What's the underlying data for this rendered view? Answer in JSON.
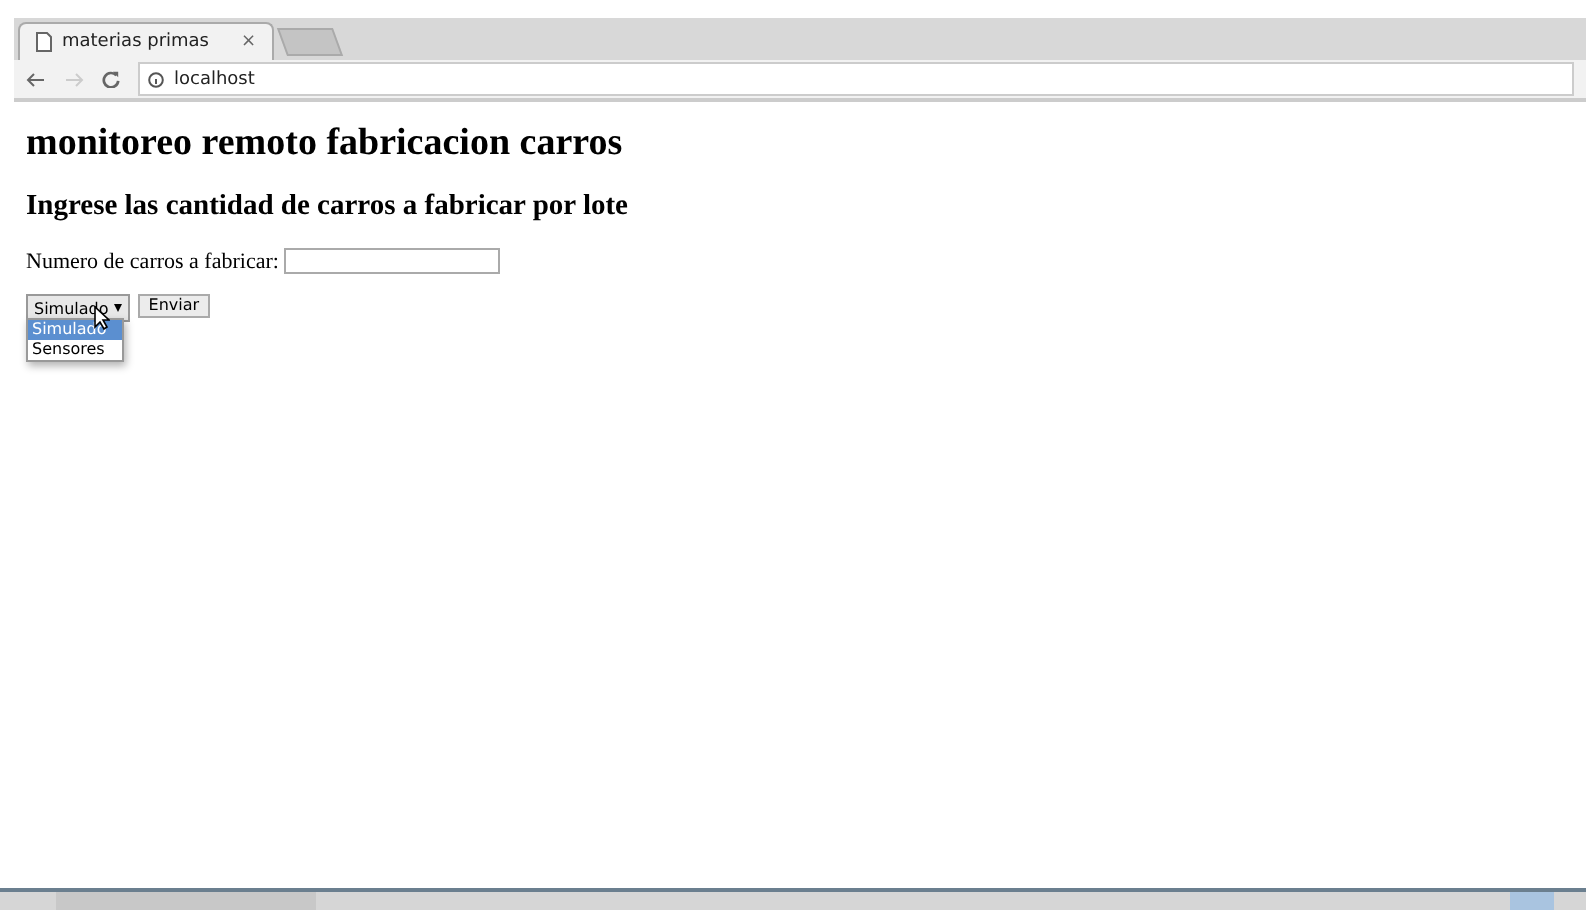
{
  "browser": {
    "tab": {
      "title": "materias primas",
      "close": "×"
    },
    "address": "localhost"
  },
  "page": {
    "title": "monitoreo remoto fabricacion carros",
    "subtitle": "Ingrese las cantidad de carros a fabricar por lote",
    "field_label": "Numero de carros a fabricar:",
    "select": {
      "value": "Simulado",
      "expanded": true,
      "options": [
        {
          "label": "Simulado",
          "selected": true
        },
        {
          "label": "Sensores",
          "selected": false
        }
      ]
    },
    "button": "Enviar"
  }
}
